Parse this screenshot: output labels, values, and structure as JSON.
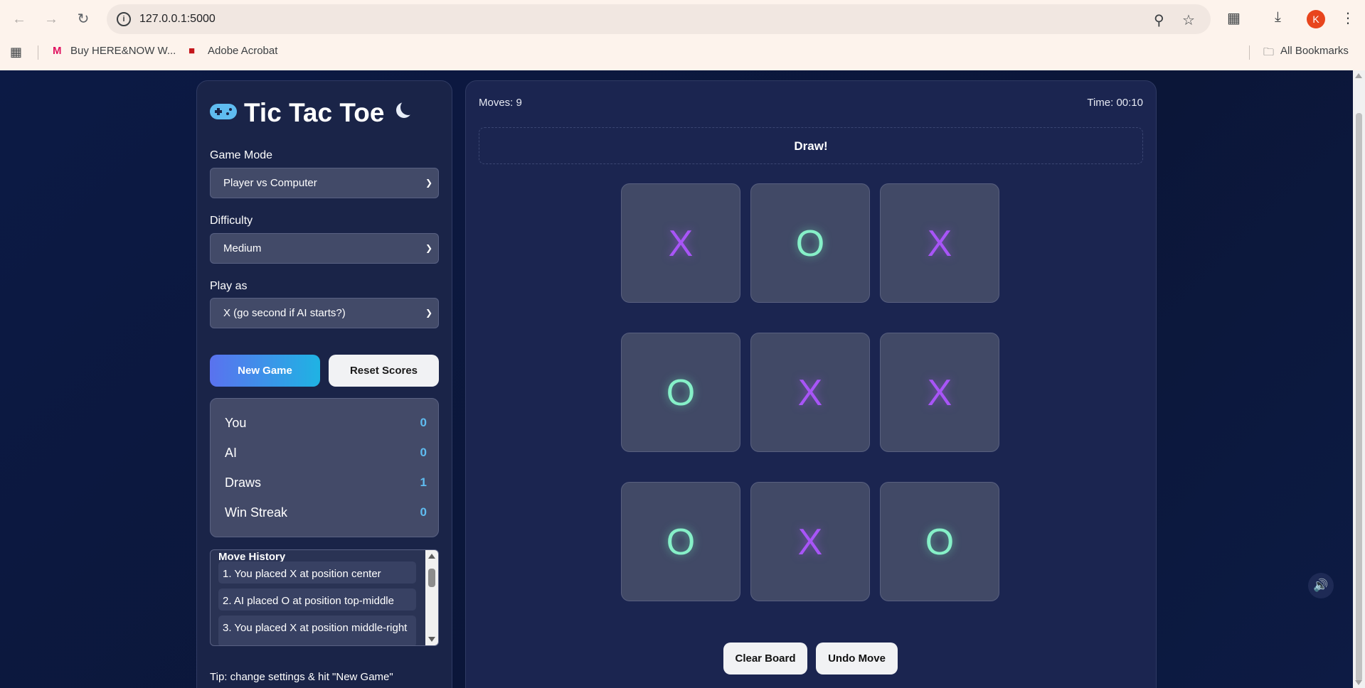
{
  "browser": {
    "url": "127.0.0.1:5000",
    "profile_initial": "K",
    "bookmarks": [
      {
        "label": "Buy HERE&NOW W..."
      },
      {
        "label": "Adobe Acrobat"
      }
    ],
    "all_bookmarks_label": "All Bookmarks"
  },
  "sidebar": {
    "title": "Tic Tac Toe",
    "game_mode_label": "Game Mode",
    "game_mode_value": "Player vs Computer",
    "difficulty_label": "Difficulty",
    "difficulty_value": "Medium",
    "play_as_label": "Play as",
    "play_as_value": "X (go second if AI starts?)",
    "new_game_label": "New Game",
    "reset_scores_label": "Reset Scores",
    "scores": [
      {
        "name": "You",
        "value": "0"
      },
      {
        "name": "AI",
        "value": "0"
      },
      {
        "name": "Draws",
        "value": "1"
      },
      {
        "name": "Win Streak",
        "value": "0"
      }
    ],
    "history_title": "Move History",
    "history": [
      "1. You placed X at position center",
      "2. AI placed O at position top-middle",
      "3. You placed X at position middle-right"
    ],
    "tip": "Tip: change settings & hit \"New Game\""
  },
  "board": {
    "moves_text": "Moves: 9",
    "timer_text": "Time: 00:10",
    "status": "Draw!",
    "cells": [
      "X",
      "O",
      "X",
      "O",
      "X",
      "X",
      "O",
      "X",
      "O"
    ],
    "clear_label": "Clear Board",
    "undo_label": "Undo Move"
  },
  "colors": {
    "x_color": "#a855f7",
    "o_color": "#86f0c8",
    "accent": "#5fbcf0",
    "background": "#0c1638"
  }
}
